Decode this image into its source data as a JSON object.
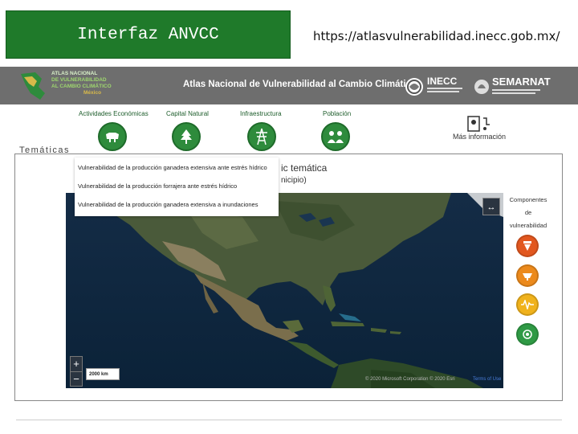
{
  "slide": {
    "title": "Interfaz ANVCC",
    "url": "https://atlasvulnerabilidad.inecc.gob.mx/"
  },
  "header": {
    "logo_text_line1": "ATLAS NACIONAL",
    "logo_text_line2": "DE VULNERABILIDAD",
    "logo_text_line3": "AL CAMBIO CLIMÁTICO",
    "logo_text_line4": "México",
    "title": "Atlas Nacional de Vulnerabilidad al Cambio Climático",
    "inecc": "INECC",
    "semarnat": "SEMARNAT"
  },
  "categories": [
    {
      "label": "Actividades Económicas",
      "icon": "cow-icon"
    },
    {
      "label": "Capital Natural",
      "icon": "tree-icon"
    },
    {
      "label": "Infraestructura",
      "icon": "tower-icon"
    },
    {
      "label": "Población",
      "icon": "people-icon"
    }
  ],
  "mas_informacion": "Más información",
  "tematicas_label": "Temáticas",
  "dropdown": {
    "items": [
      "Vulnerabilidad de la producción ganadera extensiva ante estrés hídrico",
      "Vulnerabilidad de la producción forrajera ante estrés hídrico",
      "Vulnerabilidad de la producción ganadera extensiva a inundaciones"
    ]
  },
  "behind_dropdown_text": {
    "line1": "ic temática",
    "line2": "nicipio)"
  },
  "components": {
    "title_line1": "Componentes",
    "title_line2": "de",
    "title_line3": "vulnerabilidad",
    "colors": [
      "#e2571f",
      "#ec8a1c",
      "#f0b21c",
      "#2f9a45"
    ]
  },
  "map": {
    "zoom_in": "+",
    "zoom_out": "−",
    "scale": "2000 km",
    "expand": "↔",
    "attribution": "© 2020 Microsoft Corporation © 2020 Esri",
    "terms": "Terms of Use"
  }
}
